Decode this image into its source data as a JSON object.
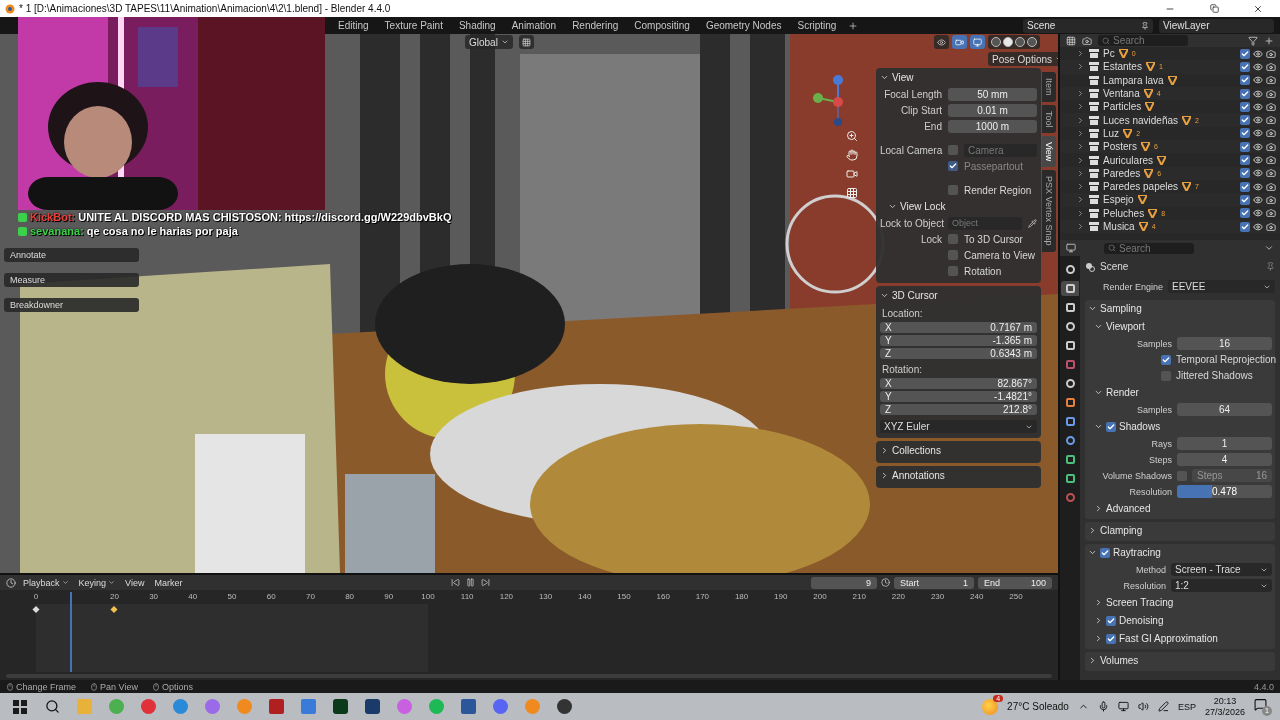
{
  "window": {
    "title": "* 1 [D:\\Animaciones\\3D TAPES\\11\\Animation\\Animacion\\4\\2\\1.blend] - Blender 4.4.0"
  },
  "workspaces": [
    {
      "label": "Editing",
      "selected": false
    },
    {
      "label": "Texture Paint",
      "selected": false
    },
    {
      "label": "Shading",
      "selected": false
    },
    {
      "label": "Animation",
      "selected": false
    },
    {
      "label": "Rendering",
      "selected": false
    },
    {
      "label": "Compositing",
      "selected": false
    },
    {
      "label": "Geometry Nodes",
      "selected": false
    },
    {
      "label": "Scripting",
      "selected": false
    }
  ],
  "scene": "Scene",
  "view_layer": "ViewLayer",
  "webcam": {
    "kind": "picture"
  },
  "chat": [
    {
      "user": "KickBot:",
      "message": "UNITE AL DISCORD MAS CHISTOSON: https://discord.gg/W229dbvBkQ",
      "color": "#e8413c"
    },
    {
      "user": "sevanana:",
      "message": "qe cosa no le harias por paja",
      "color": "#3bd14a"
    }
  ],
  "tools": [
    "Annotate",
    "Measure",
    "Breakdowner"
  ],
  "viewport": {
    "orientation": "Global",
    "pose_options": "Pose Options",
    "shading_modes": [
      {
        "selected": false
      },
      {
        "selected": true
      },
      {
        "selected": false
      },
      {
        "selected": false
      }
    ]
  },
  "sidebar": {
    "tabs": [
      {
        "label": "Item",
        "selected": false
      },
      {
        "label": "Tool",
        "selected": false
      },
      {
        "label": "View",
        "selected": true
      },
      {
        "label": "PSX Vertex Snap",
        "selected": false
      }
    ],
    "view": {
      "title": "View",
      "expanded": true,
      "fields": [
        {
          "label": "Focal Length",
          "value": "50 mm"
        },
        {
          "label": "Clip Start",
          "value": "0.01 m"
        },
        {
          "label": "End",
          "value": "1000 m"
        }
      ],
      "local_camera": {
        "label": "Local Camera",
        "checked": false,
        "value": "Camera"
      },
      "passepartout": {
        "label": "Passepartout",
        "checked": true
      },
      "render_region": {
        "label": "Render Region",
        "checked": false
      },
      "view_lock": {
        "title": "View Lock",
        "expanded": true,
        "lock_to_object": {
          "label": "Lock to Object",
          "placeholder": "Object"
        },
        "lock_label": "Lock",
        "options": [
          {
            "label": "To 3D Cursor",
            "checked": false
          },
          {
            "label": "Camera to View",
            "checked": false
          },
          {
            "label": "Rotation",
            "checked": false
          }
        ]
      }
    },
    "cursor": {
      "title": "3D Cursor",
      "expanded": true,
      "location_label": "Location:",
      "location": [
        {
          "axis": "X",
          "value": "0.7167 m"
        },
        {
          "axis": "Y",
          "value": "-1.365 m"
        },
        {
          "axis": "Z",
          "value": "0.6343 m"
        }
      ],
      "rotation_label": "Rotation:",
      "rotation": [
        {
          "axis": "X",
          "value": "82.867°"
        },
        {
          "axis": "Y",
          "value": "-1.4821°"
        },
        {
          "axis": "Z",
          "value": "212.8°"
        }
      ],
      "mode": "XYZ Euler"
    },
    "panels": [
      {
        "title": "Collections",
        "expanded": false
      },
      {
        "title": "Annotations",
        "expanded": false
      }
    ]
  },
  "outliner": {
    "search": {
      "placeholder": "Search"
    },
    "rows": [
      {
        "name": "Pc",
        "count": "0",
        "expandable": true,
        "checked": true
      },
      {
        "name": "Estantes",
        "count": "1",
        "expandable": true,
        "checked": true
      },
      {
        "name": "Lampara lava",
        "expandable": false,
        "checked": true
      },
      {
        "name": "Ventana",
        "count": "4",
        "expandable": true,
        "checked": true
      },
      {
        "name": "Particles",
        "expandable": true,
        "checked": true
      },
      {
        "name": "Luces navideñas",
        "count": "2",
        "expandable": true,
        "checked": true
      },
      {
        "name": "Luz",
        "count": "2",
        "expandable": true,
        "checked": true
      },
      {
        "name": "Posters",
        "count": "6",
        "expandable": true,
        "checked": true
      },
      {
        "name": "Auriculares",
        "expandable": true,
        "checked": true
      },
      {
        "name": "Paredes",
        "count": "6",
        "expandable": true,
        "checked": true
      },
      {
        "name": "Paredes papeles",
        "count": "7",
        "expandable": true,
        "checked": true
      },
      {
        "name": "Espejo",
        "expandable": true,
        "checked": true
      },
      {
        "name": "Peluches",
        "count": "8",
        "expandable": true,
        "checked": true
      },
      {
        "name": "Musica",
        "count": "4",
        "expandable": true,
        "checked": true
      }
    ]
  },
  "properties": {
    "search": {
      "placeholder": "Search"
    },
    "context": "Scene",
    "tabs": [
      {
        "selected": false
      },
      {
        "selected": true
      },
      {
        "selected": false
      },
      {
        "selected": false
      },
      {
        "selected": false
      },
      {
        "selected": false
      },
      {
        "selected": false
      },
      {
        "selected": false
      },
      {
        "selected": false
      },
      {
        "selected": false
      },
      {
        "selected": false
      },
      {
        "selected": false
      },
      {
        "selected": false
      }
    ],
    "render_engine": {
      "label": "Render Engine",
      "value": "EEVEE"
    },
    "sections": [
      {
        "label": "Sampling",
        "expanded": true,
        "children": [
          {
            "kind": "section",
            "label": "Viewport",
            "expanded": true,
            "children": [
              {
                "kind": "number",
                "label": "Samples",
                "value": "16"
              },
              {
                "kind": "check",
                "label": "Temporal Reprojection",
                "checked": true
              },
              {
                "kind": "check",
                "label": "Jittered Shadows",
                "checked": false
              }
            ]
          },
          {
            "kind": "section",
            "label": "Render",
            "expanded": true,
            "children": [
              {
                "kind": "number",
                "label": "Samples",
                "value": "64"
              }
            ]
          },
          {
            "kind": "section",
            "label": "Shadows",
            "expanded": true,
            "checked": true,
            "children": [
              {
                "kind": "number",
                "label": "Rays",
                "value": "1"
              },
              {
                "kind": "number",
                "label": "Steps",
                "value": "4"
              },
              {
                "kind": "volume",
                "label": "Volume Shadows",
                "checked": false,
                "field_label": "Steps",
                "value": "16"
              },
              {
                "kind": "slider",
                "label": "Resolution",
                "value": "0.478",
                "level": 0.37
              }
            ]
          },
          {
            "kind": "section",
            "label": "Advanced",
            "expanded": false
          }
        ]
      },
      {
        "label": "Clamping",
        "expanded": false
      },
      {
        "label": "Raytracing",
        "expanded": true,
        "checked": true,
        "children": [
          {
            "kind": "dropdown",
            "label": "Method",
            "value": "Screen - Trace"
          },
          {
            "kind": "dropdown",
            "label": "Resolution",
            "value": "1:2"
          },
          {
            "kind": "section",
            "label": "Screen Tracing",
            "expanded": false
          },
          {
            "kind": "section",
            "label": "Denoising",
            "expanded": false,
            "checked": true
          },
          {
            "kind": "section",
            "label": "Fast GI Approximation",
            "expanded": false,
            "checked": true
          }
        ]
      },
      {
        "label": "Volumes",
        "expanded": false
      }
    ]
  },
  "timeline": {
    "menus": [
      "Playback",
      "Keying",
      "View",
      "Marker"
    ],
    "current_frame": "9",
    "start": {
      "label": "Start",
      "value": "1"
    },
    "end": {
      "label": "End",
      "value": "100"
    },
    "ticks": [
      {
        "label": "0",
        "color": "#dcdcdc"
      },
      {
        "label": "20",
        "color": "#f2c14e"
      },
      {
        "label": "30"
      },
      {
        "label": "40"
      },
      {
        "label": "50"
      },
      {
        "label": "60"
      },
      {
        "label": "70"
      },
      {
        "label": "80"
      },
      {
        "label": "90"
      },
      {
        "label": "100"
      },
      {
        "label": "110"
      },
      {
        "label": "120"
      },
      {
        "label": "130"
      },
      {
        "label": "140"
      },
      {
        "label": "150"
      },
      {
        "label": "160"
      },
      {
        "label": "170"
      },
      {
        "label": "180"
      },
      {
        "label": "190"
      },
      {
        "label": "200"
      },
      {
        "label": "210"
      },
      {
        "label": "220"
      },
      {
        "label": "230"
      },
      {
        "label": "240"
      },
      {
        "label": "250"
      }
    ]
  },
  "status_bar": {
    "hints": [
      "Change Frame",
      "Pan View",
      "Options"
    ],
    "version": "4.4.0"
  },
  "taskbar": {
    "weather_badge": "4",
    "weather": "27°C Soleado",
    "language": "ESP",
    "time": "20:13",
    "date": "27/3/2026",
    "notification_count": "1"
  }
}
